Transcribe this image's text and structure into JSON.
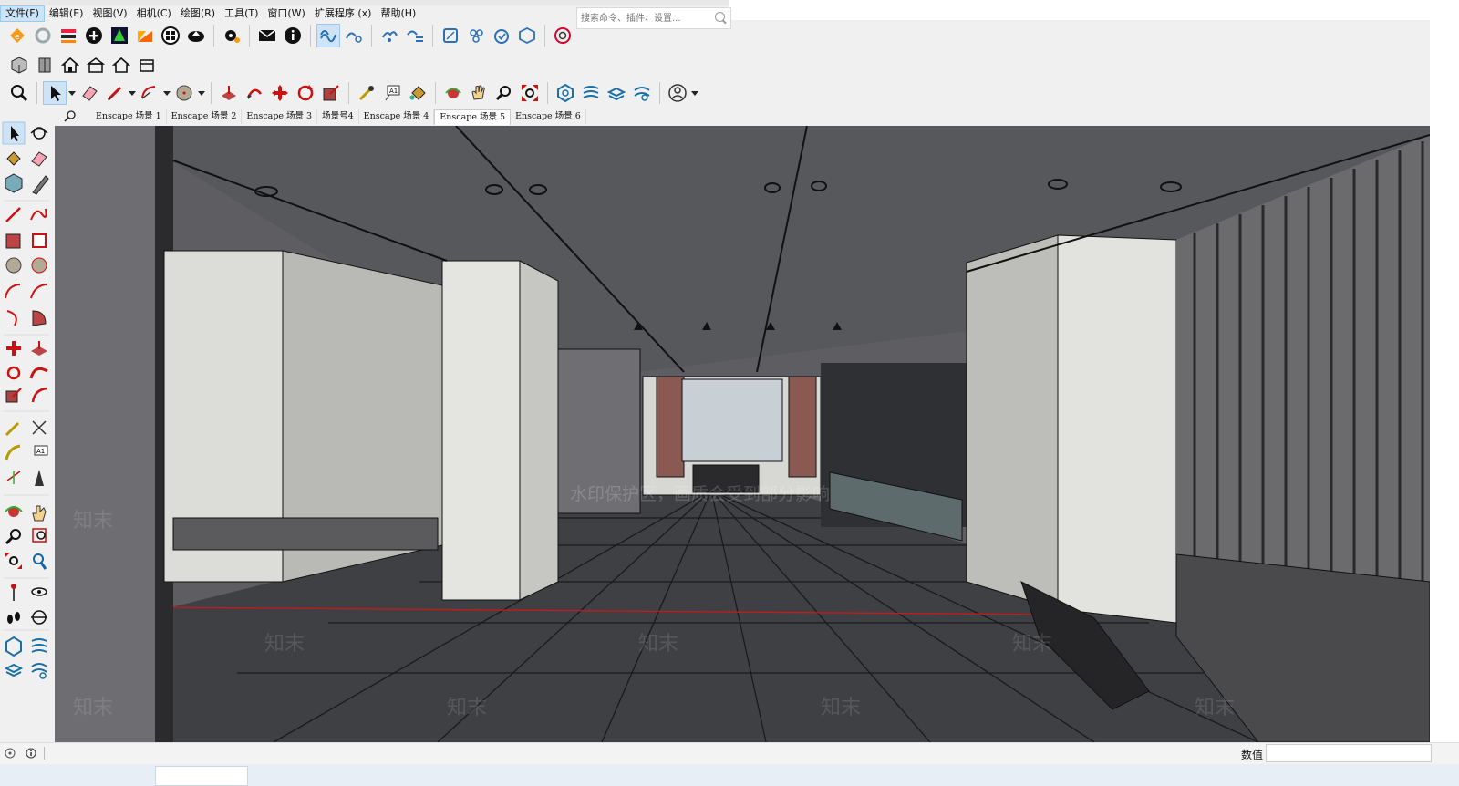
{
  "menu": {
    "items": [
      {
        "label": "文件(F)",
        "active": true
      },
      {
        "label": "编辑(E)"
      },
      {
        "label": "视图(V)"
      },
      {
        "label": "相机(C)"
      },
      {
        "label": "绘图(R)"
      },
      {
        "label": "工具(T)"
      },
      {
        "label": "窗口(W)"
      },
      {
        "label": "扩展程序 (x)"
      },
      {
        "label": "帮助(H)"
      }
    ]
  },
  "search": {
    "placeholder": "搜索命令、插件、设置..."
  },
  "scenes": {
    "tabs": [
      "Enscape 场景 1",
      "Enscape 场景 2",
      "Enscape 场景 3",
      "场景号4",
      "Enscape 场景 4",
      "Enscape 场景 5",
      "Enscape 场景 6"
    ],
    "active_index": 5
  },
  "viewport": {
    "watermark_banner": "水印保护区，画质会受到部分影响",
    "watermark_text": "知末"
  },
  "status": {
    "measure_label": "数值"
  },
  "colors": {
    "accent": "#cfe3f6",
    "viewport_bg": "#5d5d62",
    "floor": "#3f4044",
    "wall": "#d8d8d4"
  }
}
